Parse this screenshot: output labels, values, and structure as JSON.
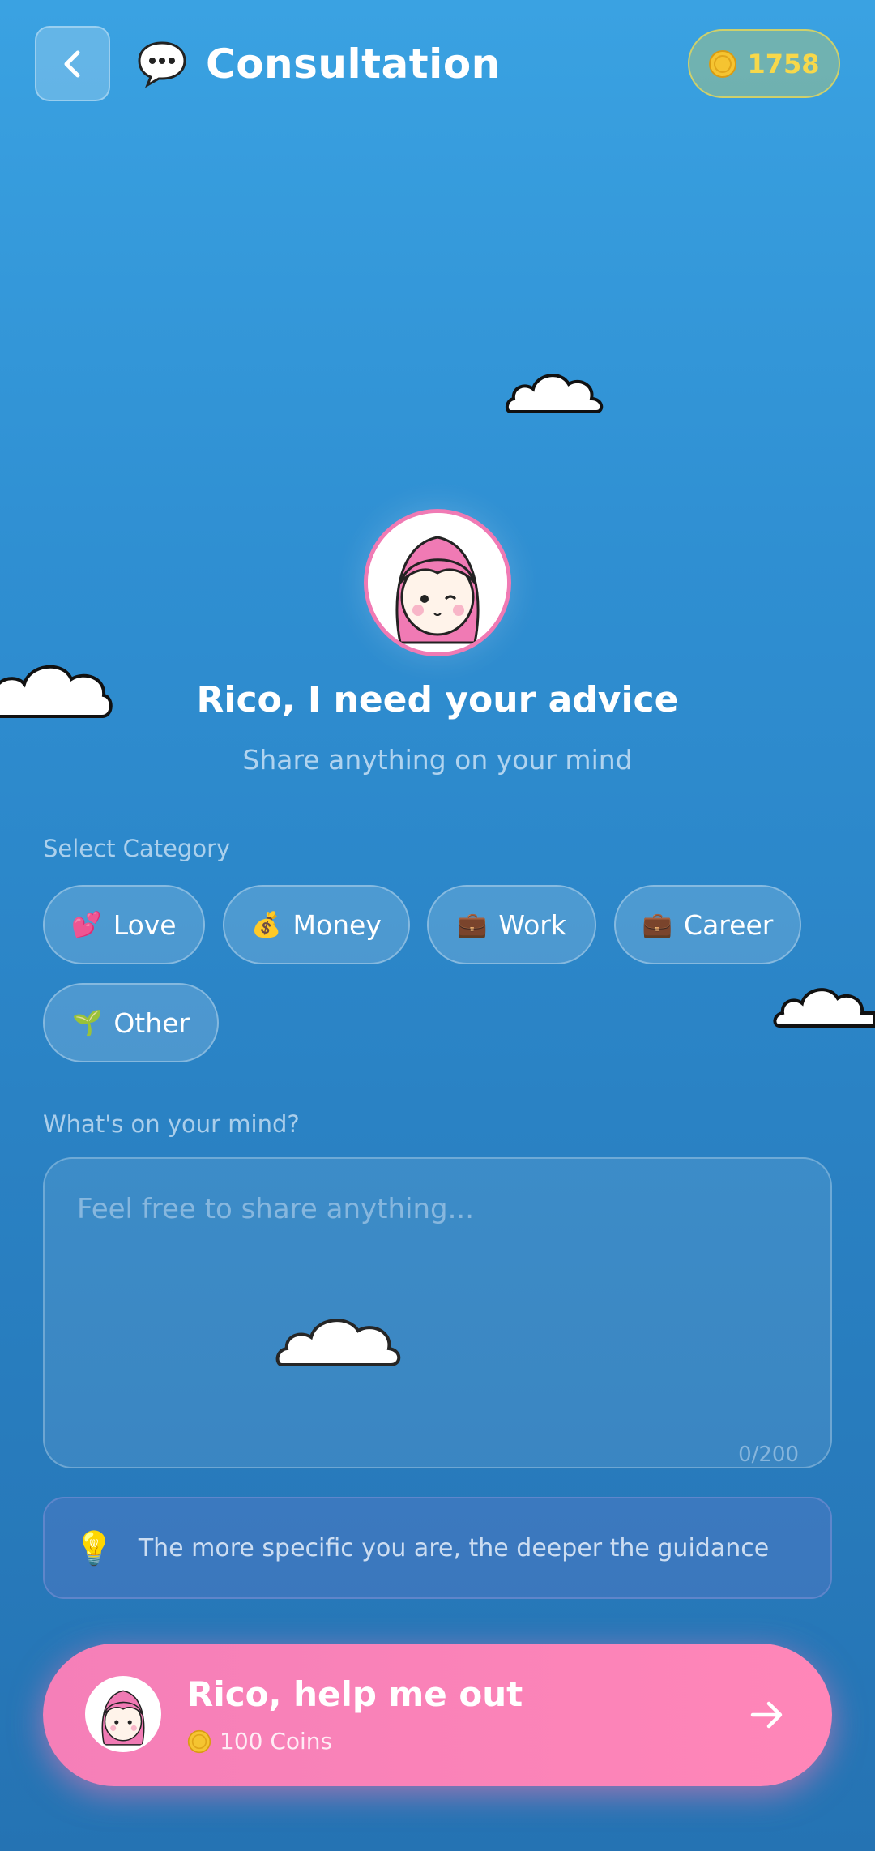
{
  "header": {
    "title": "Consultation",
    "title_icon": "speech-bubble-icon",
    "coins": "1758"
  },
  "hero": {
    "title": "Rico, I need your advice",
    "subtitle": "Share anything on your mind"
  },
  "category": {
    "label": "Select Category",
    "chips": [
      {
        "emoji": "💕",
        "label": "Love"
      },
      {
        "emoji": "💰",
        "label": "Money"
      },
      {
        "emoji": "💼",
        "label": "Work"
      },
      {
        "emoji": "💼",
        "label": "Career"
      },
      {
        "emoji": "🌱",
        "label": "Other"
      }
    ]
  },
  "input": {
    "label": "What's on your mind?",
    "placeholder": "Feel free to share anything...",
    "counter": "0/200"
  },
  "tip": {
    "emoji": "💡",
    "text": "The more specific you are, the deeper the guidance"
  },
  "cta": {
    "title": "Rico, help me out",
    "cost": "100 Coins"
  },
  "colors": {
    "accent_pink": "#f57fb8",
    "coin_gold": "#f7d84a",
    "bg_top": "#3aa2e2",
    "bg_bottom": "#2573b3"
  }
}
